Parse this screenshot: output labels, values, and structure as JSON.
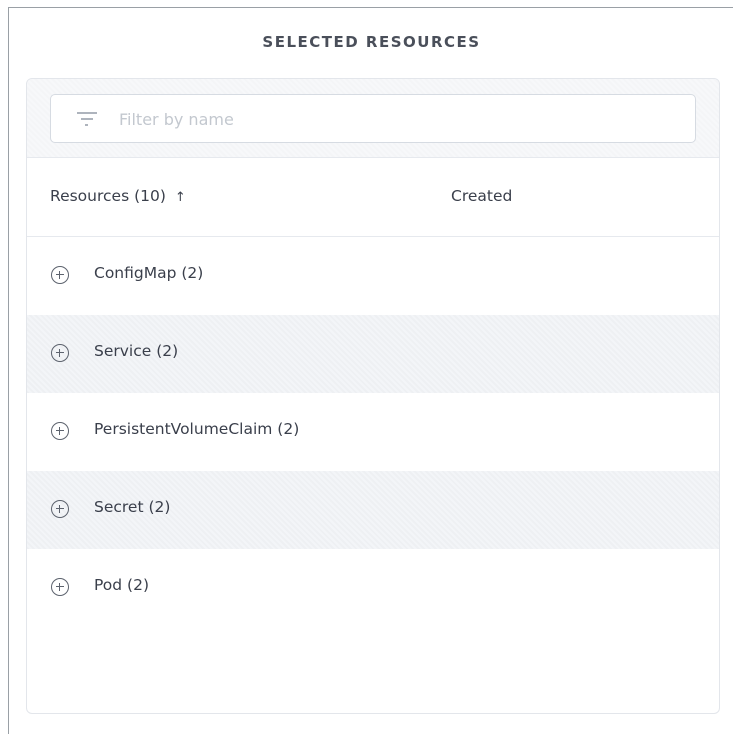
{
  "panel": {
    "title": "SELECTED RESOURCES"
  },
  "filter": {
    "placeholder": "Filter by name",
    "value": "",
    "icon": "filter-icon"
  },
  "table": {
    "columns": {
      "resources": "Resources (10)",
      "sort_indicator": "↑",
      "created": "Created"
    },
    "rows": [
      {
        "label": "ConfigMap (2)",
        "icon": "plus-circle-icon"
      },
      {
        "label": "Service (2)",
        "icon": "plus-circle-icon"
      },
      {
        "label": "PersistentVolumeClaim (2)",
        "icon": "plus-circle-icon"
      },
      {
        "label": "Secret (2)",
        "icon": "plus-circle-icon"
      },
      {
        "label": "Pod (2)",
        "icon": "plus-circle-icon"
      }
    ]
  },
  "colors": {
    "alt_row": "#f3f5f8",
    "text": "#3a3f4b",
    "border": "#e3e6eb"
  }
}
